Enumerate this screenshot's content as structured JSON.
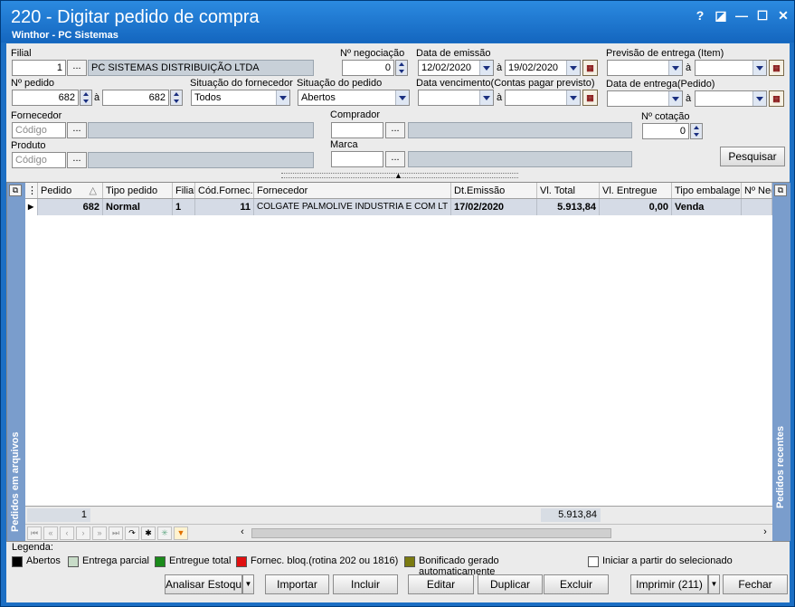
{
  "window": {
    "title": "220 - Digitar pedido de compra",
    "subtitle": "Winthor - PC Sistemas",
    "controls": [
      "?",
      "◪",
      "—",
      "☐",
      "✕"
    ]
  },
  "filters": {
    "filial_label": "Filial",
    "filial_value": "1",
    "filial_name": "PC SISTEMAS DISTRIBUIÇÃO LTDA",
    "negociacao_label": "Nº negociação",
    "negociacao_value": "0",
    "emissao_label": "Data de emissão",
    "emissao_from": "12/02/2020",
    "emissao_to": "19/02/2020",
    "previsao_label": "Previsão  de entrega (Item)",
    "pedido_label": "Nº pedido",
    "pedido_from": "682",
    "pedido_to": "682",
    "sit_fornecedor_label": "Situação do fornecedor",
    "sit_fornecedor_value": "Todos",
    "sit_pedido_label": "Situação do pedido",
    "sit_pedido_value": "Abertos",
    "vencimento_label": "Data vencimento(Contas pagar previsto)",
    "entrega_label": "Data de entrega(Pedido)",
    "fornecedor_label": "Fornecedor",
    "comprador_label": "Comprador",
    "cotacao_label": "Nº cotação",
    "cotacao_value": "0",
    "produto_label": "Produto",
    "marca_label": "Marca",
    "codigo_placeholder": "Código",
    "range_sep": "à",
    "dots": "...",
    "search_button": "Pesquisar"
  },
  "grid": {
    "columns": [
      "Pedido",
      "Tipo pedido",
      "Filial",
      "Cód.Fornec.",
      "Fornecedor",
      "Dt.Emissão",
      "Vl. Total",
      "Vl. Entregue",
      "Tipo embalagem",
      "Nº Neg"
    ],
    "rows": [
      {
        "pedido": "682",
        "tipo": "Normal",
        "filial": "1",
        "cod": "11",
        "fornecedor": "COLGATE PALMOLIVE INDUSTRIA  E COM LT",
        "emissao": "17/02/2020",
        "total": "5.913,84",
        "entregue": "0,00",
        "embalagem": "Venda"
      }
    ],
    "footer_count": "1",
    "footer_total": "5.913,84",
    "left_panel": "Pedidos em arquivos",
    "right_panel": "Pedidos recentes"
  },
  "legend": {
    "title": "Legenda:",
    "items": [
      {
        "label": "Abertos",
        "color": "#000000"
      },
      {
        "label": "Entrega parcial",
        "color": "#c8dcc8"
      },
      {
        "label": "Entregue total",
        "color": "#1a8a1a"
      },
      {
        "label": "Fornec. bloq.(rotina 202 ou 1816)",
        "color": "#e01010"
      },
      {
        "label": "Bonificado gerado automaticamente",
        "color": "#7a7a10"
      }
    ],
    "checkbox_label": "Iniciar a partir do selecionado"
  },
  "actions": {
    "analisar": "Analisar Estoque",
    "importar": "Importar",
    "incluir": "Incluir",
    "editar": "Editar",
    "duplicar": "Duplicar",
    "excluir": "Excluir",
    "imprimir": "Imprimir (211)",
    "fechar": "Fechar"
  }
}
